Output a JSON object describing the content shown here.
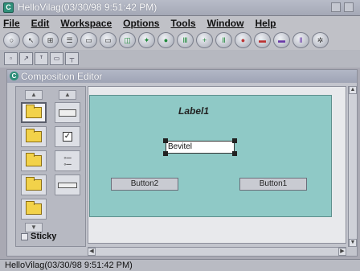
{
  "window": {
    "title": "HelloVilag(03/30/98 9:51:42 PM)",
    "icon": "C"
  },
  "menu": [
    "File",
    "Edit",
    "Workspace",
    "Options",
    "Tools",
    "Window",
    "Help"
  ],
  "toolbar": {
    "icons": [
      "save-icon",
      "cursor-icon",
      "tools-icon",
      "list-icon",
      "bean-icon",
      "bean2-icon",
      "connect-icon",
      "add-icon",
      "run-icon",
      "test-icon",
      "plus-icon",
      "align-icon",
      "stop-icon",
      "stop2-icon",
      "layout-icon",
      "properties-icon",
      "gear-icon"
    ]
  },
  "toolbar2": {
    "icons": [
      "align-left-icon",
      "arrow-icon",
      "text-icon",
      "window-icon",
      "menu-icon"
    ]
  },
  "editor": {
    "title": "Composition Editor",
    "icon": "C",
    "palette": {
      "sticky_label": "Sticky"
    },
    "canvas": {
      "label": "Label1",
      "textfield_value": "Bevitel",
      "button2": "Button2",
      "button1": "Button1"
    }
  },
  "statusbar": {
    "text": "HelloVilag(03/30/98 9:51:42 PM)"
  }
}
